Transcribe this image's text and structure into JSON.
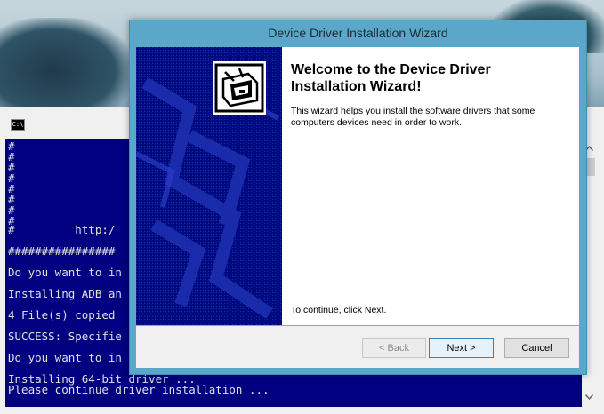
{
  "console": {
    "icon_label": "C:\\",
    "lines": [
      "#",
      "#",
      "#",
      "#",
      "#",
      "#",
      "#",
      "#",
      "#         http:/",
      "################",
      "Do you want to in",
      "Installing ADB an",
      "4 File(s) copied",
      "SUCCESS: Specifie",
      "Do you want to in",
      "Installing 64-bit driver ...",
      "Please continue driver installation ..."
    ]
  },
  "wizard": {
    "title": "Device Driver Installation Wizard",
    "heading": "Welcome to the Device Driver Installation Wizard!",
    "description": "This wizard helps you install the software drivers that some computers devices need in order to work.",
    "continue_text": "To continue, click Next.",
    "buttons": {
      "back": "< Back",
      "next": "Next >",
      "cancel": "Cancel"
    }
  },
  "colors": {
    "console_bg": "#000080",
    "wizard_frame": "#5aa7c9",
    "sidebar_bg": "#000a80"
  },
  "icons": [
    "console-app-icon",
    "device-hardware-icon",
    "scroll-up-icon",
    "scroll-down-icon"
  ]
}
